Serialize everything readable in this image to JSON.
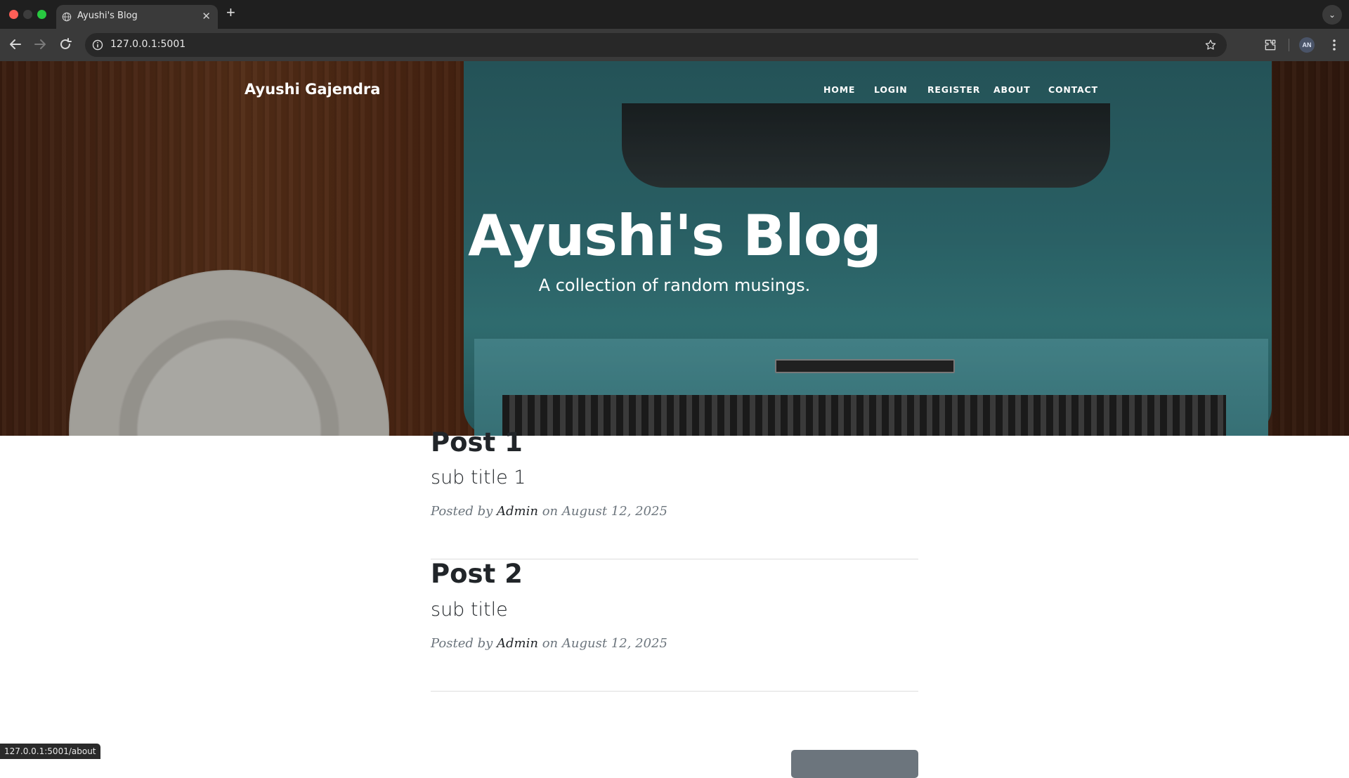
{
  "browser": {
    "tab_title": "Ayushi's Blog",
    "url": "127.0.0.1:5001",
    "profile_initials": "AN",
    "status_url": "127.0.0.1:5001/about"
  },
  "site": {
    "brand": "Ayushi Gajendra",
    "nav": [
      "HOME",
      "LOGIN",
      "REGISTER",
      "ABOUT",
      "CONTACT"
    ],
    "hero_title": "Ayushi's Blog",
    "hero_subtitle": "A collection of random musings."
  },
  "posts": [
    {
      "title": "Post 1",
      "subtitle": "sub title 1",
      "meta_prefix": "Posted by",
      "author": "Admin",
      "meta_middle": "on",
      "date": "August 12, 2025"
    },
    {
      "title": "Post 2",
      "subtitle": "sub title",
      "meta_prefix": "Posted by",
      "author": "Admin",
      "meta_middle": "on",
      "date": "August 12, 2025"
    }
  ],
  "icons": {
    "back": "arrow-left-icon",
    "forward": "arrow-right-icon",
    "reload": "reload-icon",
    "info": "info-icon",
    "bookmark": "star-icon",
    "extensions": "puzzle-icon",
    "menu": "more-vertical-icon"
  }
}
